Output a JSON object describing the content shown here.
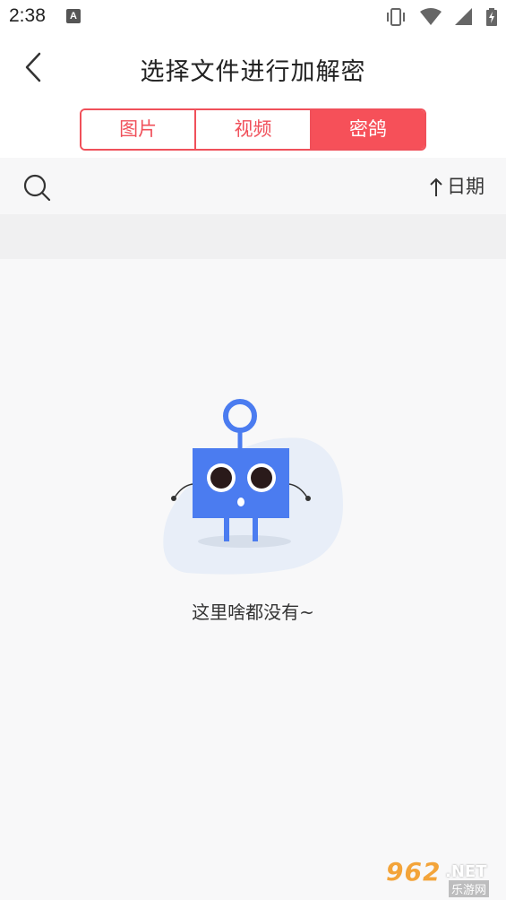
{
  "status_bar": {
    "time": "2:38",
    "notification_icon": "A",
    "icons": [
      "vibrate-icon",
      "wifi-icon",
      "signal-icon",
      "battery-charging-icon"
    ]
  },
  "header": {
    "title": "选择文件进行加解密",
    "back_icon": "chevron-left-icon"
  },
  "tabs": [
    {
      "label": "图片",
      "active": false
    },
    {
      "label": "视频",
      "active": false
    },
    {
      "label": "密鸽",
      "active": true
    }
  ],
  "toolbar": {
    "search_icon": "search-icon",
    "sort_label": "日期",
    "sort_icon": "arrow-up-icon"
  },
  "empty_state": {
    "message": "这里啥都没有~",
    "illustration": "robot-illustration"
  },
  "watermark": {
    "brand": "962",
    "suffix": ".NET",
    "subtitle": "乐游网"
  },
  "colors": {
    "accent": "#f65059",
    "robot_blue": "#4b7cf0",
    "blob": "#e8eef8"
  }
}
